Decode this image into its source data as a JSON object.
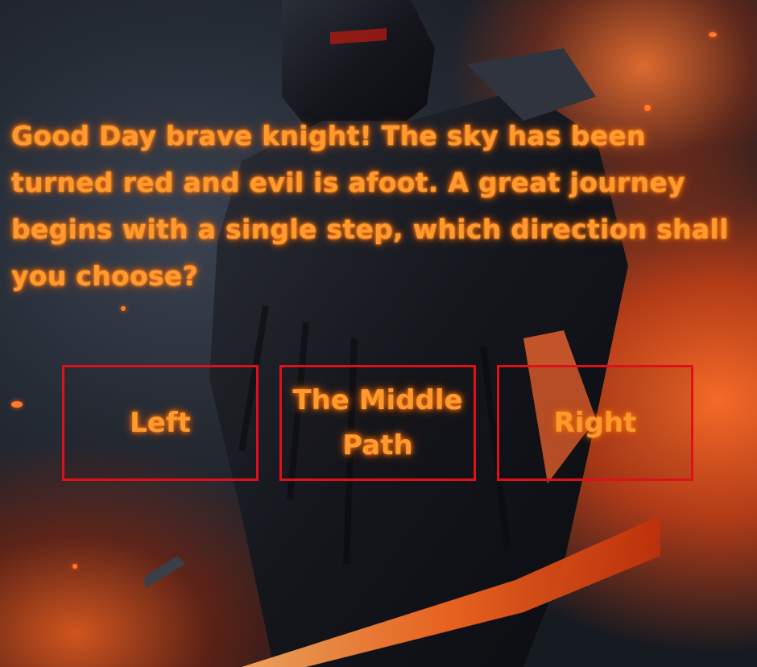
{
  "story": {
    "text": "Good Day brave knight! The sky has been turned red and evil is afoot. A great journey begins with a single step, which direction shall you choose?"
  },
  "choices": {
    "left": "Left",
    "middle": "The Middle Path",
    "right": "Right"
  },
  "colors": {
    "text": "#ff9a2e",
    "border": "#e0101a",
    "fire": "#ff6a20"
  }
}
